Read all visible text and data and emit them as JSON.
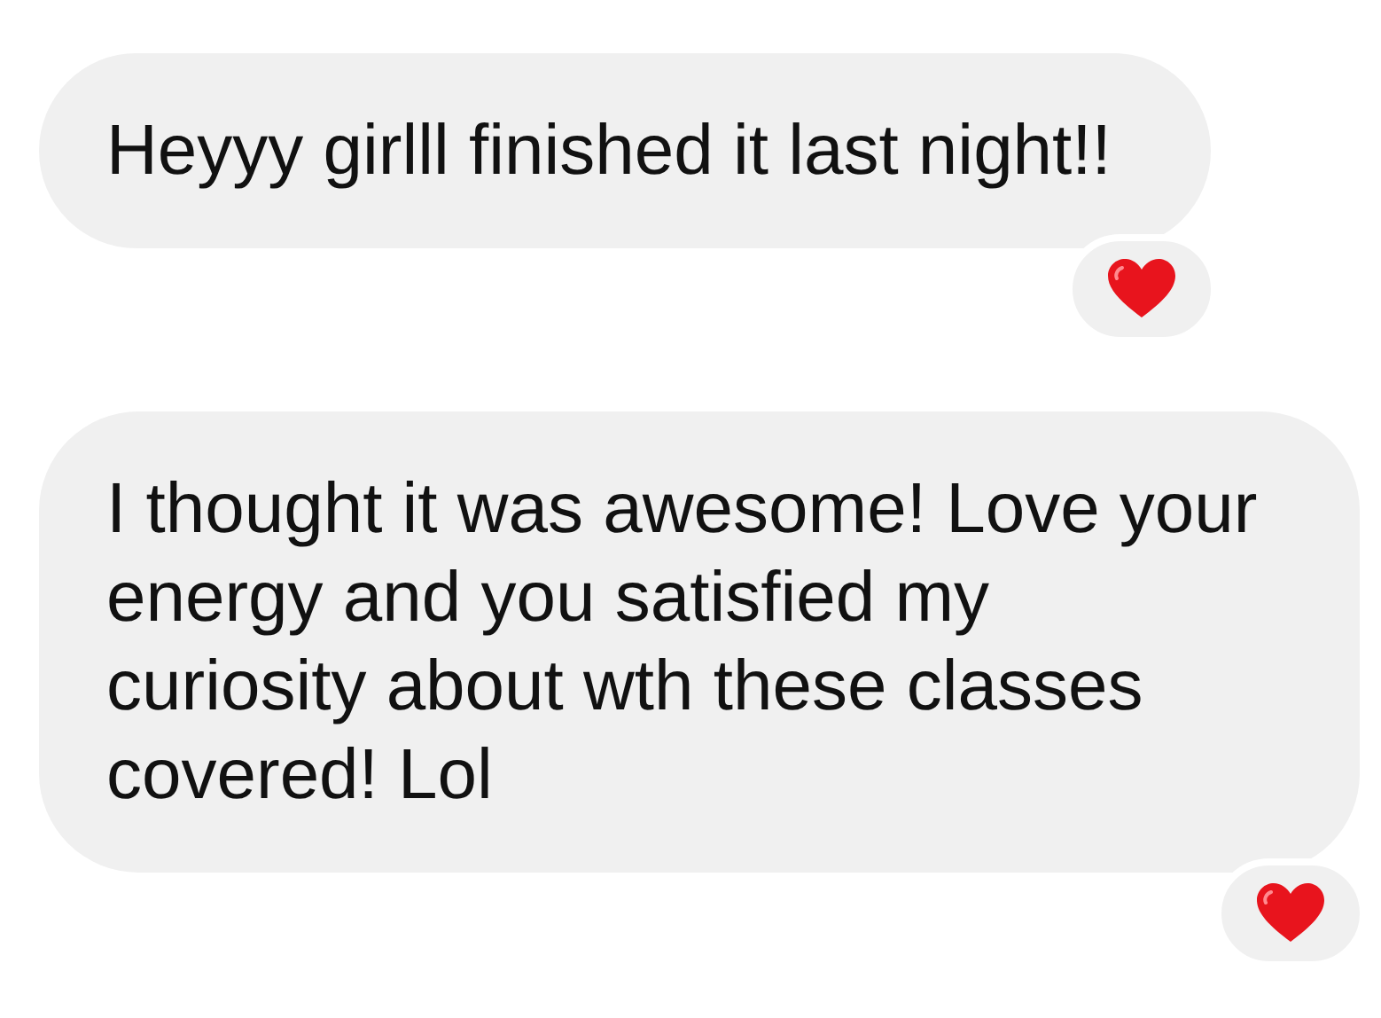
{
  "messages": [
    {
      "text": "Heyyy girlll finished it last night!!",
      "reaction": {
        "kind": "heart"
      }
    },
    {
      "text": "I thought it was awesome! Love your energy and you satisfied my curiosity about wth these classes covered! Lol",
      "reaction": {
        "kind": "heart"
      }
    }
  ]
}
